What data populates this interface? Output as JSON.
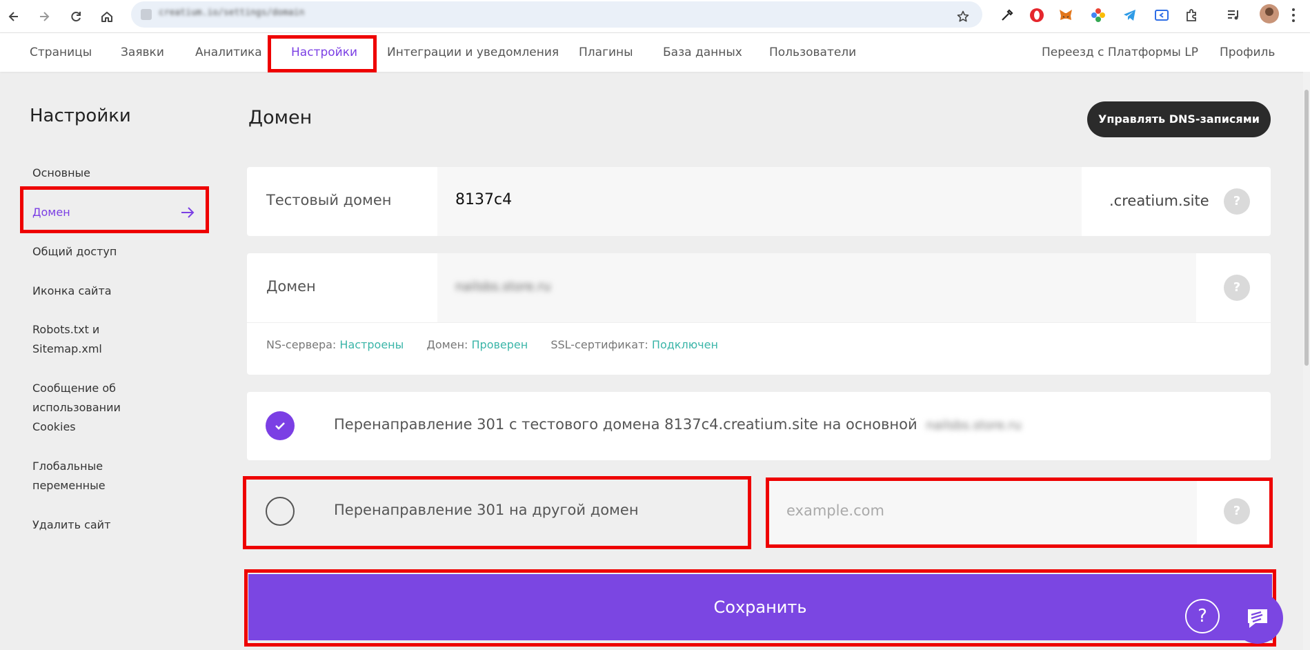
{
  "browser": {
    "url": "creatium.io/settings/domain",
    "icons": [
      "back-icon",
      "forward-icon",
      "reload-icon",
      "home-icon",
      "star-icon",
      "eyedropper-extension-icon",
      "opera-extension-icon",
      "metamask-extension-icon",
      "pinwheel-extension-icon",
      "telegram-extension-icon",
      "tab-extension-icon",
      "puzzle-extensions-icon",
      "media-queue-icon",
      "avatar",
      "menu-icon"
    ]
  },
  "topnav": {
    "items": [
      "Страницы",
      "Заявки",
      "Аналитика",
      "Настройки",
      "Интеграции и уведомления",
      "Плагины",
      "База данных",
      "Пользователи"
    ],
    "right_items": [
      "Переезд с Платформы LP",
      "Профиль"
    ],
    "active": "Настройки"
  },
  "sidebar": {
    "title": "Настройки",
    "items": [
      {
        "label": "Основные"
      },
      {
        "label": "Домен"
      },
      {
        "label": "Общий доступ"
      },
      {
        "label": "Иконка сайта"
      },
      {
        "label": "Robots.txt и Sitemap.xml"
      },
      {
        "label": "Сообщение об использовании Cookies"
      },
      {
        "label": "Глобальные переменные"
      },
      {
        "label": "Удалить сайт"
      }
    ],
    "active": "Домен"
  },
  "main": {
    "title": "Домен",
    "dns_button": "Управлять DNS-записями",
    "test_domain": {
      "label": "Тестовый домен",
      "value": "8137c4",
      "suffix": ".creatium.site",
      "help": "?"
    },
    "domain": {
      "label": "Домен",
      "value": "nailsbs.store.ru",
      "help": "?"
    },
    "status": {
      "ns_label": "NS-сервера:",
      "ns_value": "Настроены",
      "domain_label": "Домен:",
      "domain_value": "Проверен",
      "ssl_label": "SSL-сертификат:",
      "ssl_value": "Подключен"
    },
    "redirect_test": {
      "text": "Перенаправление 301 с тестового домена 8137c4.creatium.site на основной",
      "target": "nailsbs.store.ru",
      "checked": true
    },
    "redirect_other": {
      "text": "Перенаправление 301 на другой домен",
      "checked": false,
      "placeholder": "example.com",
      "help": "?"
    },
    "save_button": "Сохранить",
    "help_fab": "?"
  },
  "colors": {
    "accent": "#7b46e2",
    "status_ok": "#3ab5a8",
    "highlight": "#ee0000",
    "dark_button": "#2b2b2b"
  }
}
